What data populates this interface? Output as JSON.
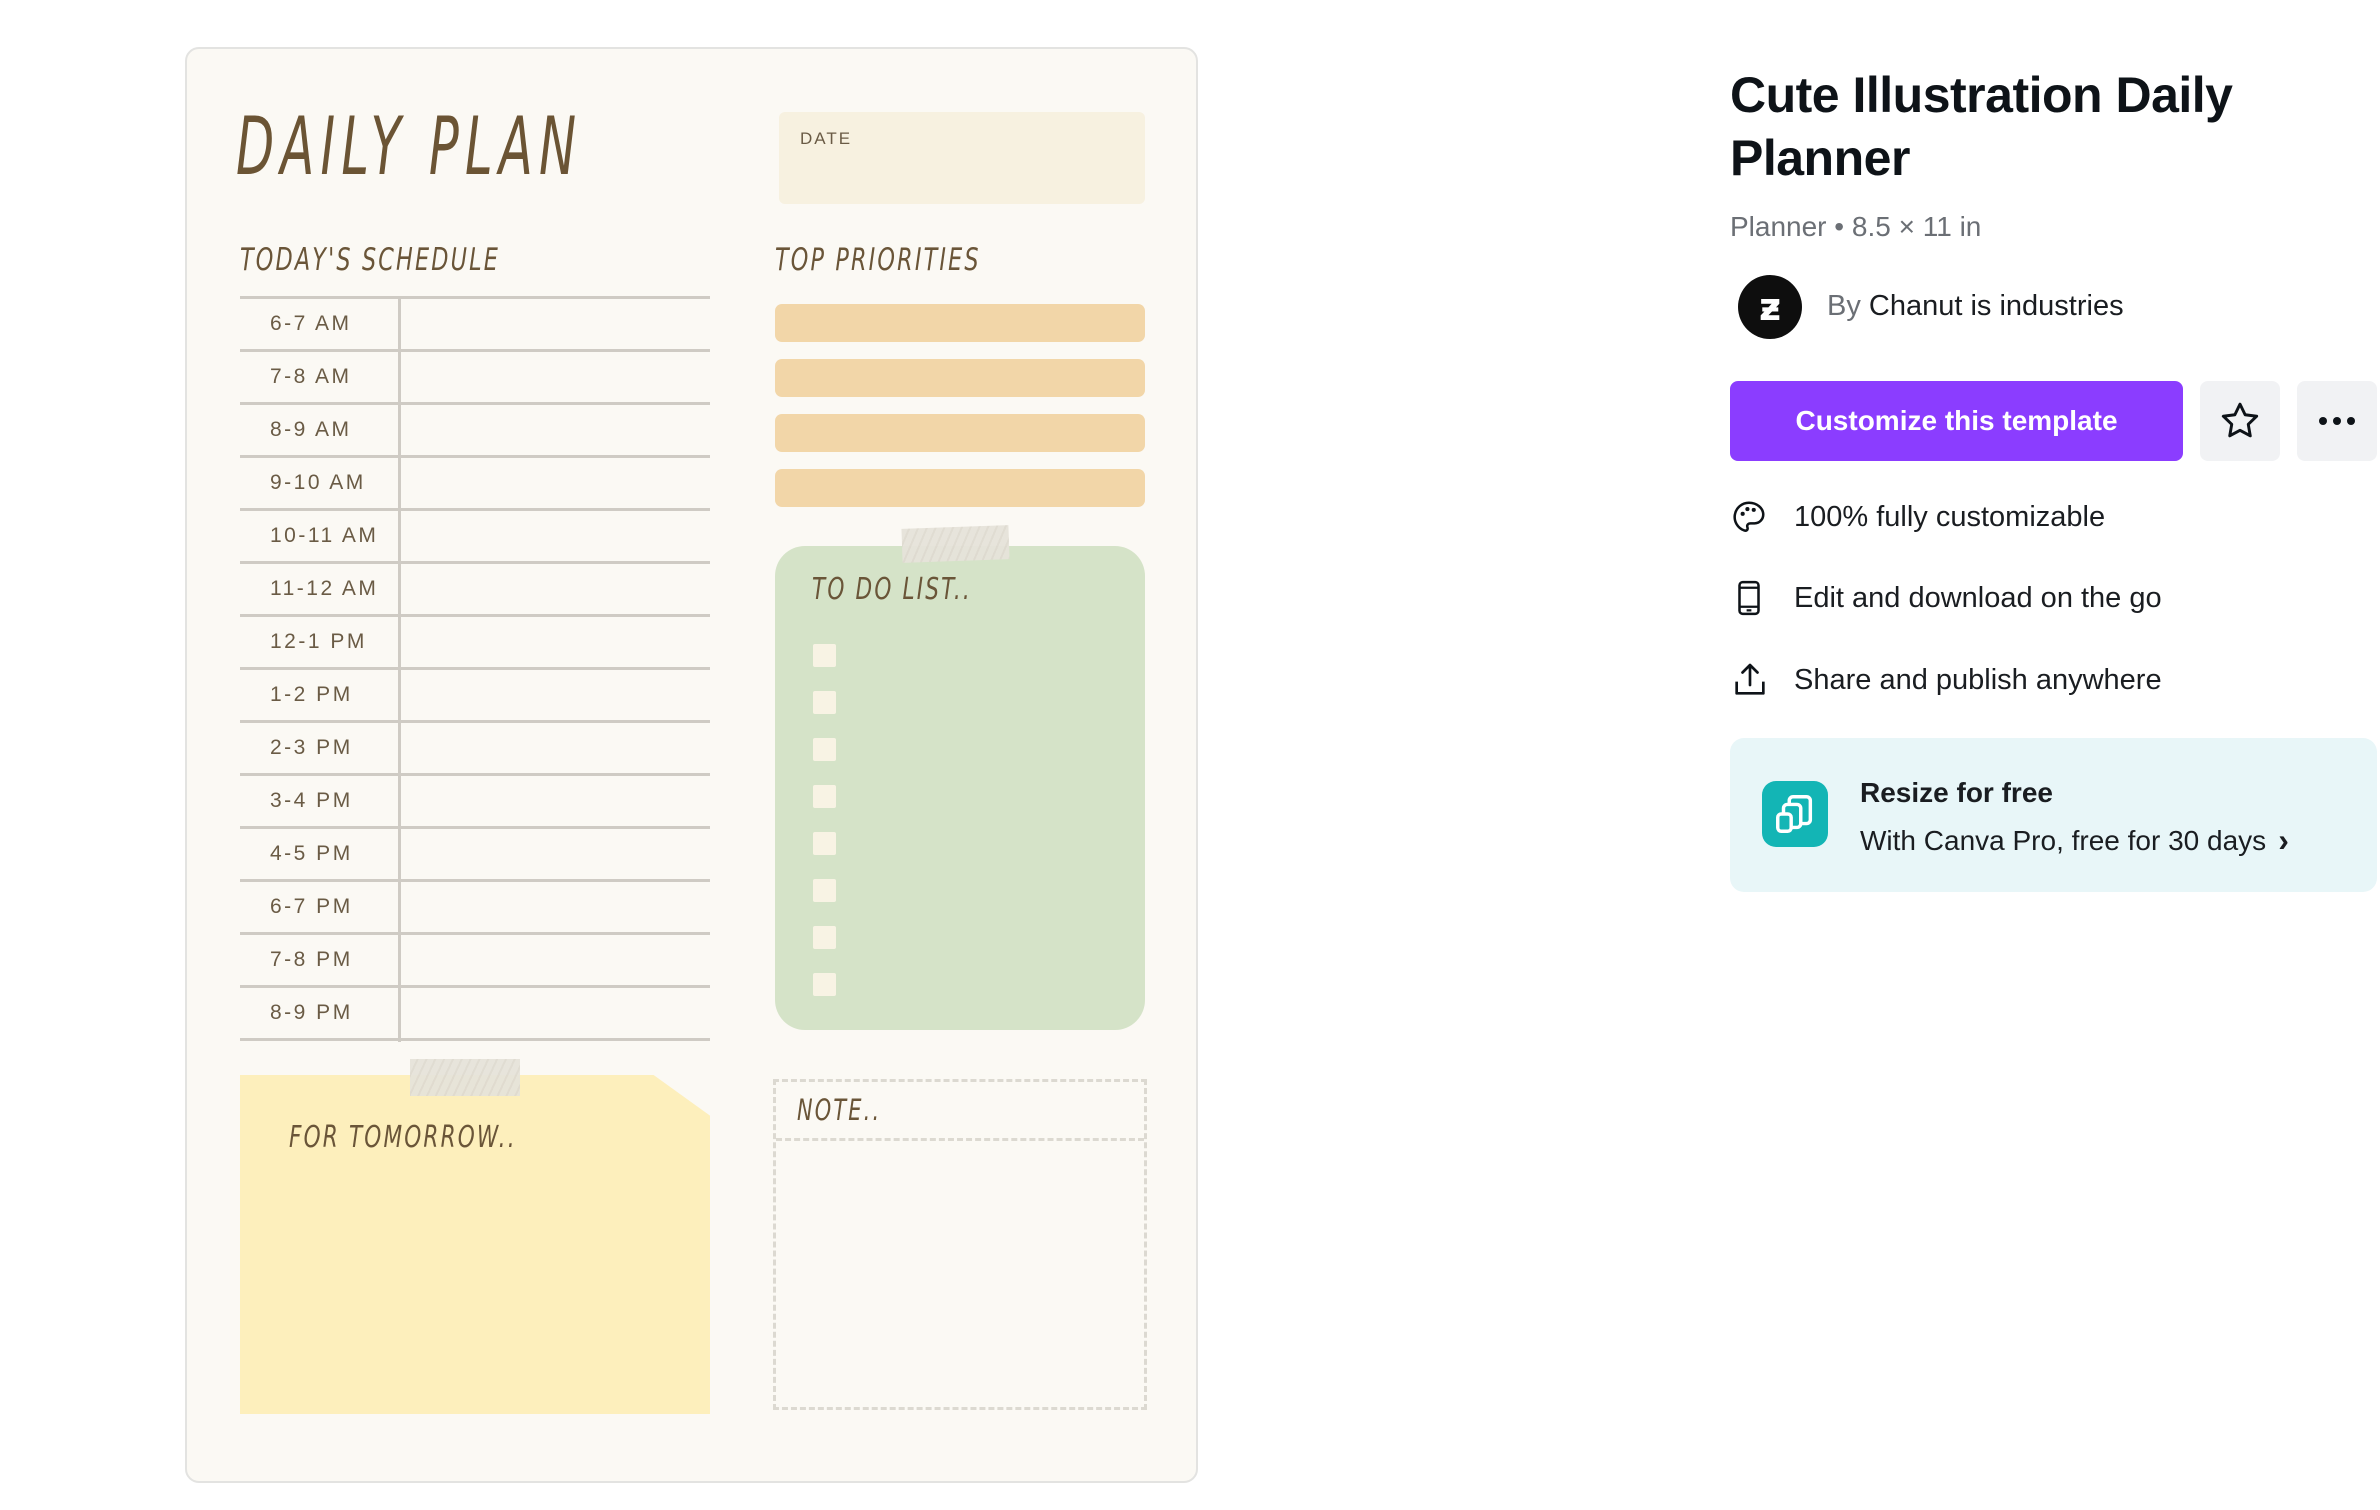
{
  "planner": {
    "title": "DAILY PLAN",
    "date_label": "DATE",
    "schedule_title": "TODAY'S SCHEDULE",
    "priorities_title": "TOP PRIORITIES",
    "priority_count": 4,
    "schedule": [
      "6-7 AM",
      "7-8 AM",
      "8-9 AM",
      "9-10 AM",
      "10-11 AM",
      "11-12 AM",
      "12-1 PM",
      "1-2 PM",
      "2-3 PM",
      "3-4 PM",
      "4-5 PM",
      "6-7 PM",
      "7-8 PM",
      "8-9 PM"
    ],
    "todo_title": "TO DO LIST..",
    "todo_checkbox_count": 8,
    "tomorrow_title": "FOR TOMORROW..",
    "note_title": "NOTE..",
    "colors": {
      "priority": "#f2d6a8",
      "todo": "#d5e3c8",
      "tomorrow": "#fdefbc",
      "paper": "#fbf9f4",
      "ink": "#6b5434"
    }
  },
  "details": {
    "title": "Cute Illustration Daily Planner",
    "type": "Planner",
    "separator": "•",
    "size": "8.5 × 11 in",
    "author_prefix": "By",
    "author": "Chanut is industries",
    "avatar_glyph": "ƶ",
    "customize_label": "Customize this template",
    "star_icon": "star-icon",
    "more_icon": "more-horizontal-icon",
    "features": [
      {
        "icon": "palette-icon",
        "label": "100% fully customizable"
      },
      {
        "icon": "phone-icon",
        "label": "Edit and download on the go"
      },
      {
        "icon": "share-upload-icon",
        "label": "Share and publish anywhere"
      }
    ],
    "resize": {
      "icon": "resize-icon",
      "title": "Resize for free",
      "subtitle": "With Canva Pro, free for 30 days",
      "chevron": "›"
    },
    "accent_color": "#8b3dff"
  }
}
